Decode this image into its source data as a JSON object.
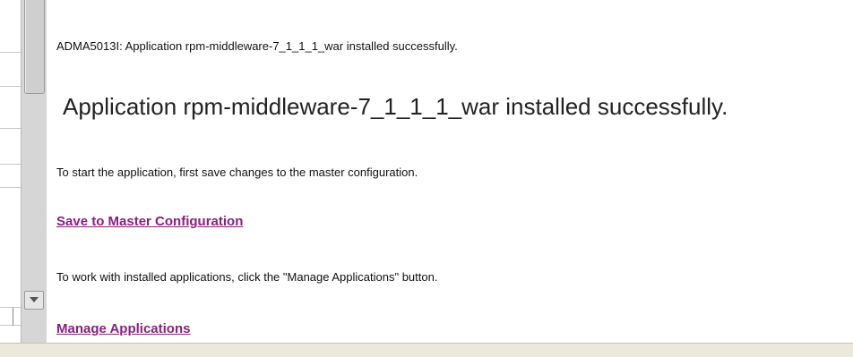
{
  "message": {
    "code_line": "ADMA5013I: Application rpm-middleware-7_1_1_1_war installed successfully.",
    "headline": "Application rpm-middleware-7_1_1_1_war installed successfully."
  },
  "instructions": {
    "save_text": "To start the application, first save changes to the master configuration.",
    "save_link": "Save to Master Configuration",
    "manage_text": "To work with installed applications, click the \"Manage Applications\" button.",
    "manage_link": "Manage Applications"
  },
  "colors": {
    "link": "#8a1f7f",
    "scrollbar": "#d6d6d6",
    "status_bar": "#ede8dc"
  },
  "icons": {
    "scroll_down": "triangle-down"
  }
}
